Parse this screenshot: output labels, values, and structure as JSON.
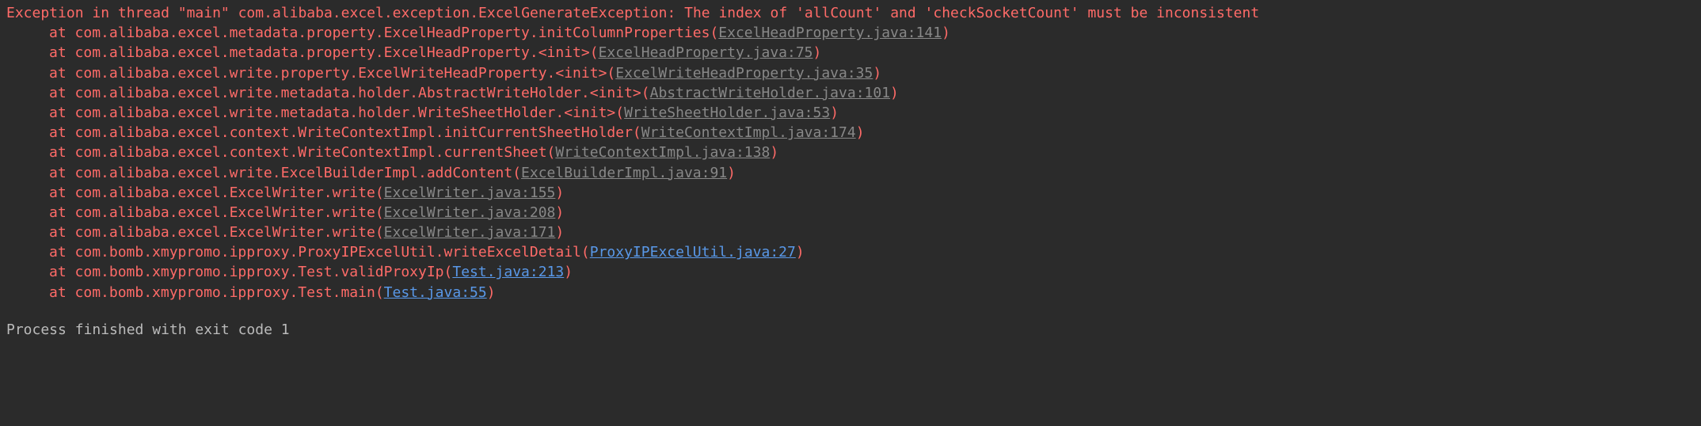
{
  "exception_header": "Exception in thread \"main\" com.alibaba.excel.exception.ExcelGenerateException: The index of 'allCount' and 'checkSocketCount' must be inconsistent",
  "stack_frames": [
    {
      "at": "at ",
      "method": "com.alibaba.excel.metadata.property.ExcelHeadProperty.initColumnProperties",
      "source": "ExcelHeadProperty.java:141",
      "link_type": "gray"
    },
    {
      "at": "at ",
      "method": "com.alibaba.excel.metadata.property.ExcelHeadProperty.<init>",
      "source": "ExcelHeadProperty.java:75",
      "link_type": "gray"
    },
    {
      "at": "at ",
      "method": "com.alibaba.excel.write.property.ExcelWriteHeadProperty.<init>",
      "source": "ExcelWriteHeadProperty.java:35",
      "link_type": "gray"
    },
    {
      "at": "at ",
      "method": "com.alibaba.excel.write.metadata.holder.AbstractWriteHolder.<init>",
      "source": "AbstractWriteHolder.java:101",
      "link_type": "gray"
    },
    {
      "at": "at ",
      "method": "com.alibaba.excel.write.metadata.holder.WriteSheetHolder.<init>",
      "source": "WriteSheetHolder.java:53",
      "link_type": "gray"
    },
    {
      "at": "at ",
      "method": "com.alibaba.excel.context.WriteContextImpl.initCurrentSheetHolder",
      "source": "WriteContextImpl.java:174",
      "link_type": "gray"
    },
    {
      "at": "at ",
      "method": "com.alibaba.excel.context.WriteContextImpl.currentSheet",
      "source": "WriteContextImpl.java:138",
      "link_type": "gray"
    },
    {
      "at": "at ",
      "method": "com.alibaba.excel.write.ExcelBuilderImpl.addContent",
      "source": "ExcelBuilderImpl.java:91",
      "link_type": "gray"
    },
    {
      "at": "at ",
      "method": "com.alibaba.excel.ExcelWriter.write",
      "source": "ExcelWriter.java:155",
      "link_type": "gray"
    },
    {
      "at": "at ",
      "method": "com.alibaba.excel.ExcelWriter.write",
      "source": "ExcelWriter.java:208",
      "link_type": "gray"
    },
    {
      "at": "at ",
      "method": "com.alibaba.excel.ExcelWriter.write",
      "source": "ExcelWriter.java:171",
      "link_type": "gray"
    },
    {
      "at": "at ",
      "method": "com.bomb.xmypromo.ipproxy.ProxyIPExcelUtil.writeExcelDetail",
      "source": "ProxyIPExcelUtil.java:27",
      "link_type": "blue"
    },
    {
      "at": "at ",
      "method": "com.bomb.xmypromo.ipproxy.Test.validProxyIp",
      "source": "Test.java:213",
      "link_type": "blue"
    },
    {
      "at": "at ",
      "method": "com.bomb.xmypromo.ipproxy.Test.main",
      "source": "Test.java:55",
      "link_type": "blue"
    }
  ],
  "process_exit": "Process finished with exit code 1"
}
